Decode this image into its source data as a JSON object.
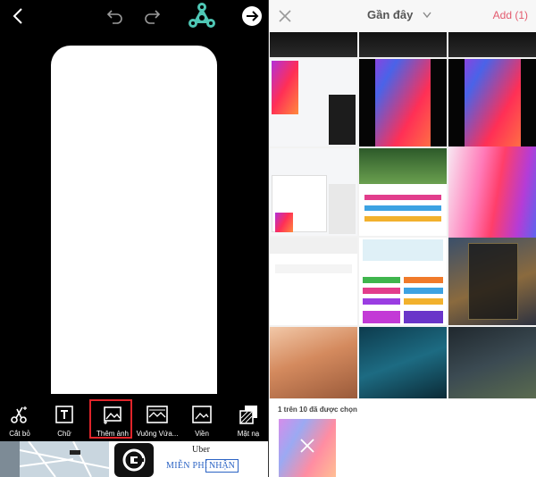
{
  "colors": {
    "accent_red": "#e0242a",
    "add_pink": "#e35a6e",
    "link_blue": "#2b63c4",
    "spinner_teal": "#4fc7b5"
  },
  "editor": {
    "icons": [
      "back-icon",
      "undo-icon",
      "redo-icon",
      "fidget-spinner-logo",
      "next-arrow-icon"
    ],
    "tools": [
      {
        "id": "cut",
        "label": "Cắt bỏ",
        "icon": "scissors-icon"
      },
      {
        "id": "text",
        "label": "Chữ",
        "icon": "text-box-icon"
      },
      {
        "id": "add-photo",
        "label": "Thêm ảnh",
        "icon": "add-photo-icon",
        "active": true
      },
      {
        "id": "square",
        "label": "Vuông Vứa...",
        "icon": "square-fit-icon"
      },
      {
        "id": "border",
        "label": "Viền",
        "icon": "border-image-icon"
      },
      {
        "id": "mask",
        "label": "Mặt nạ",
        "icon": "mask-icon"
      }
    ]
  },
  "ad": {
    "brand": "Uber",
    "price": "MIỄN PHÍ",
    "install": "NHẬN"
  },
  "gallery": {
    "title": "Gần đây",
    "add_label": "Add (1)",
    "selected_text": "1 trên 10 đã được chọn"
  }
}
